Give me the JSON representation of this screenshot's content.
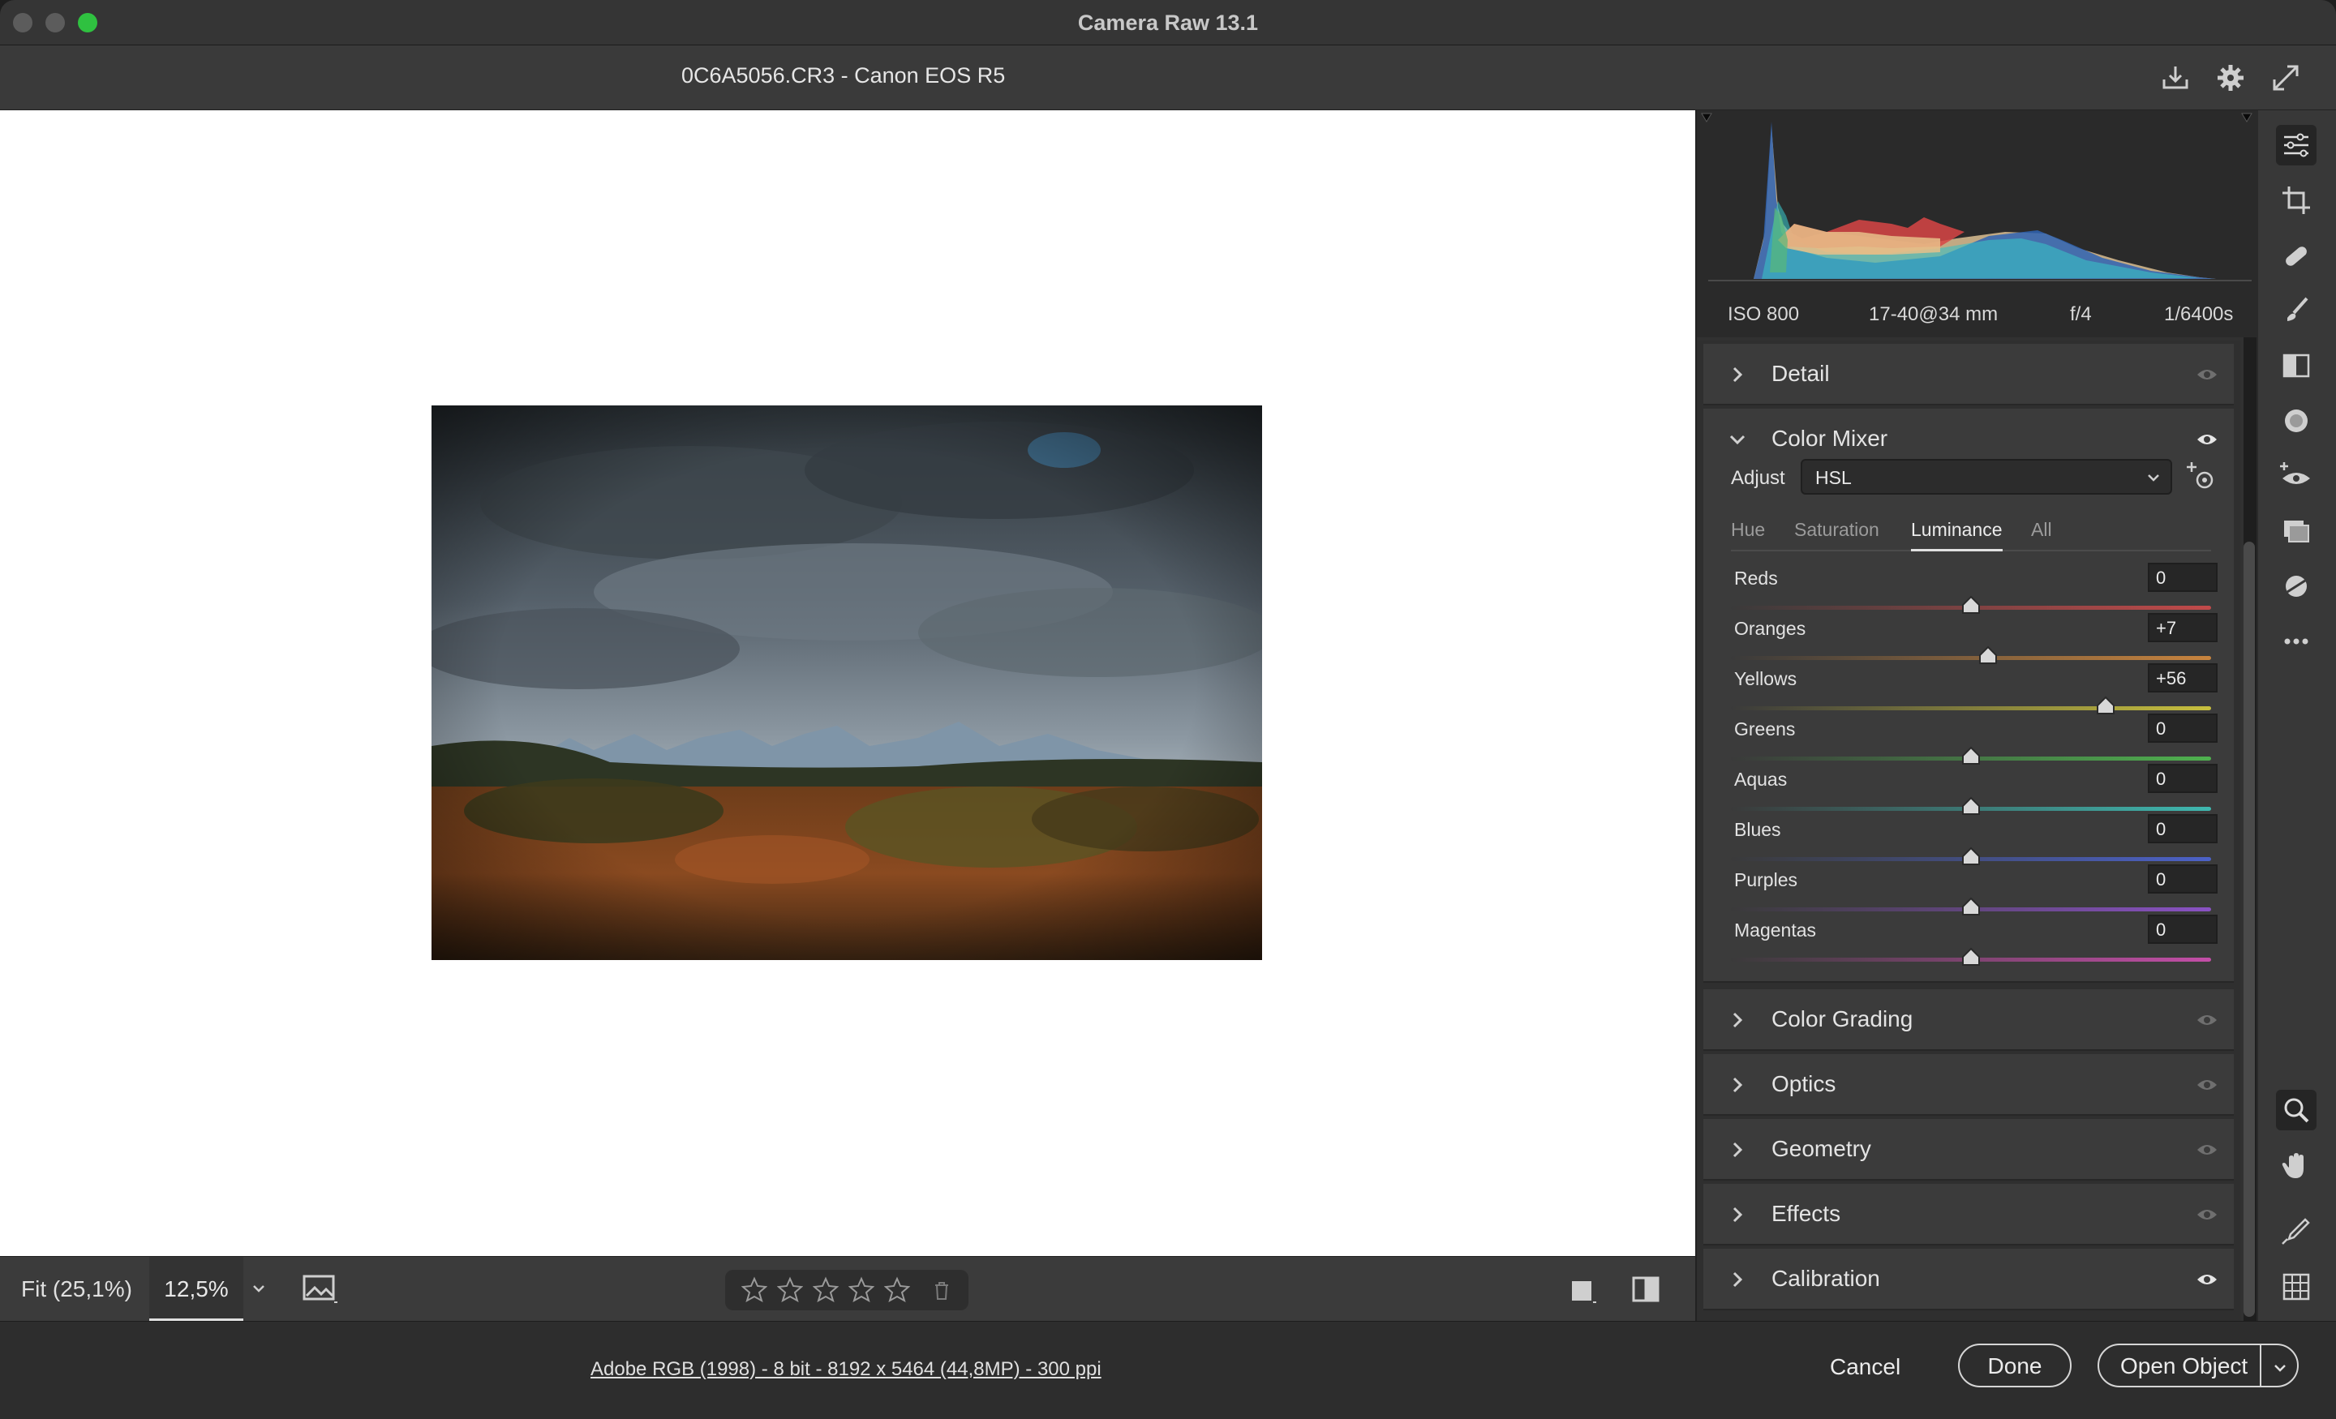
{
  "window": {
    "title": "Camera Raw 13.1"
  },
  "header": {
    "filename": "0C6A5056.CR3  -  Canon EOS R5",
    "icons": [
      "save-icon",
      "gear-icon",
      "fullscreen-icon"
    ]
  },
  "histogram": {
    "exif": {
      "iso": "ISO 800",
      "lens": "17-40@34 mm",
      "aperture": "f/4",
      "shutter": "1/6400s"
    }
  },
  "panels": {
    "detail": "Detail",
    "color_mixer": {
      "title": "Color Mixer",
      "adjust_label": "Adjust",
      "adjust_value": "HSL",
      "tabs": [
        "Hue",
        "Saturation",
        "Luminance",
        "All"
      ],
      "active_tab": "Luminance",
      "sliders": [
        {
          "name": "Reds",
          "value": "0",
          "level": 0,
          "color": "#c24a4a"
        },
        {
          "name": "Oranges",
          "value": "+7",
          "level": 7,
          "color": "#c8843e"
        },
        {
          "name": "Yellows",
          "value": "+56",
          "level": 56,
          "color": "#c8c03e"
        },
        {
          "name": "Greens",
          "value": "0",
          "level": 0,
          "color": "#4fb24f"
        },
        {
          "name": "Aquas",
          "value": "0",
          "level": 0,
          "color": "#3fb8b0"
        },
        {
          "name": "Blues",
          "value": "0",
          "level": 0,
          "color": "#4c62c8"
        },
        {
          "name": "Purples",
          "value": "0",
          "level": 0,
          "color": "#8a52c4"
        },
        {
          "name": "Magentas",
          "value": "0",
          "level": 0,
          "color": "#c44ea8"
        }
      ]
    },
    "color_grading": "Color Grading",
    "optics": "Optics",
    "geometry": "Geometry",
    "effects": "Effects",
    "calibration": "Calibration"
  },
  "canvas_bar": {
    "fit": "Fit (25,1%)",
    "zoom": "12,5%",
    "rating_stars": 5
  },
  "footer": {
    "file_info": "Adobe RGB (1998) - 8 bit - 8192 x 5464 (44,8MP) - 300 ppi",
    "cancel": "Cancel",
    "done": "Done",
    "open": "Open Object"
  },
  "colors": {
    "panel": "#3b3b3b",
    "accent": "#e0e0e0"
  }
}
